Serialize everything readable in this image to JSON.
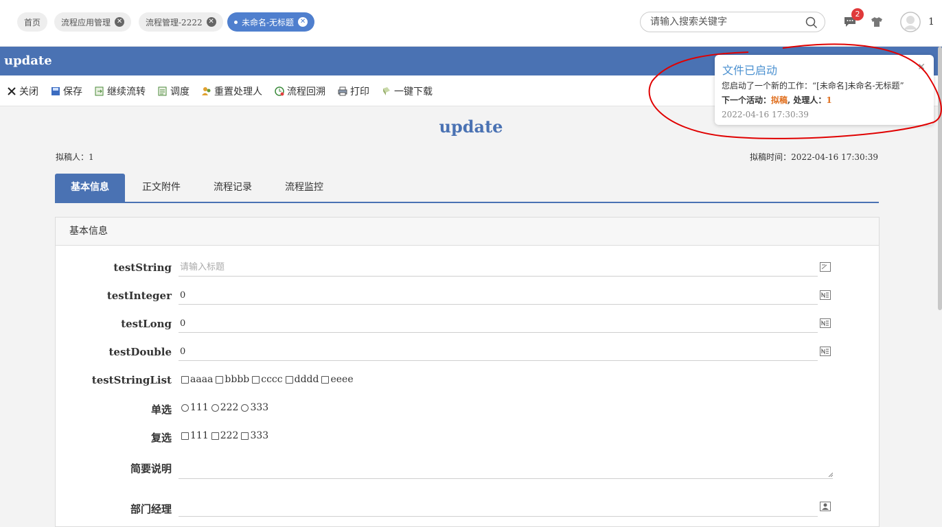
{
  "tabs": [
    {
      "label": "首页",
      "closable": false
    },
    {
      "label": "流程应用管理",
      "closable": true
    },
    {
      "label": "流程管理-2222",
      "closable": true
    },
    {
      "label": "未命名-无标题",
      "closable": true,
      "active": true
    }
  ],
  "search": {
    "placeholder": "请输入搜索关键字"
  },
  "notifications": {
    "count": "2"
  },
  "user": {
    "name": "1"
  },
  "page": {
    "title": "update"
  },
  "toolbar": {
    "close": "关闭",
    "save": "保存",
    "continue": "继续流转",
    "dispatch": "调度",
    "reset_handler": "重置处理人",
    "trace": "流程回溯",
    "print": "打印",
    "download": "一键下载"
  },
  "doc": {
    "title": "update",
    "drafter": "拟稿人：1",
    "draft_time": "拟稿时间：2022-04-16 17:30:39"
  },
  "form_tabs": [
    "基本信息",
    "正文附件",
    "流程记录",
    "流程监控"
  ],
  "panel": {
    "title": "基本信息"
  },
  "fields": {
    "testString": {
      "label": "testString",
      "placeholder": "请输入标题"
    },
    "testInteger": {
      "label": "testInteger",
      "value": "0"
    },
    "testLong": {
      "label": "testLong",
      "value": "0"
    },
    "testDouble": {
      "label": "testDouble",
      "value": "0"
    },
    "testStringList": {
      "label": "testStringList",
      "options": [
        "aaaa",
        "bbbb",
        "cccc",
        "dddd",
        "eeee"
      ]
    },
    "radio": {
      "label": "单选",
      "options": [
        "111",
        "222",
        "333"
      ]
    },
    "checkbox": {
      "label": "复选",
      "options": [
        "111",
        "222",
        "333"
      ]
    },
    "summary": {
      "label": "简要说明"
    },
    "manager": {
      "label": "部门经理"
    }
  },
  "notification": {
    "title": "文件已启动",
    "line1": "您启动了一个新的工作：“[未命名]未命名-无标题”",
    "line2_prefix": "下一个活动：",
    "activity": "拟稿",
    "line2_mid": ", 处理人：",
    "handler": "1",
    "time": "2022-04-16 17:30:39"
  },
  "colors": {
    "primary": "#4a72b3",
    "accent_orange": "#e07020",
    "badge_red": "#e0393a",
    "annotation_red": "#e00000"
  }
}
